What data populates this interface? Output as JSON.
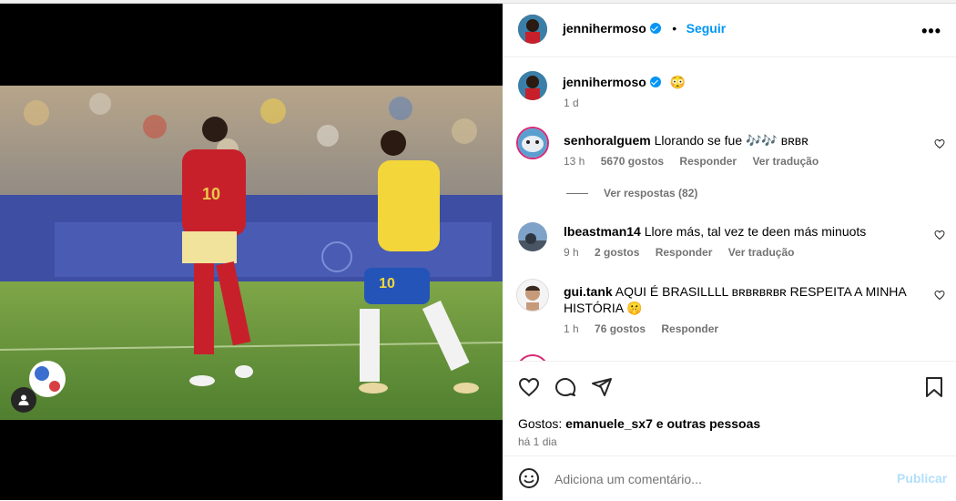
{
  "post_author": {
    "username": "jennihermoso",
    "follow_label": "Seguir",
    "more_icon": "more-icon"
  },
  "caption": {
    "username": "jennihermoso",
    "emoji": "😳",
    "time": "1 d"
  },
  "photo": {
    "player_left_number": "10",
    "player_right_number": "10"
  },
  "comments": [
    {
      "username": "senhoralguem",
      "text": "Llorando se fue 🎶🎶 ʙʀʙʀ",
      "time": "13 h",
      "likes": "5670 gostos",
      "reply": "Responder",
      "translate": "Ver tradução",
      "view_replies": "Ver respostas (82)"
    },
    {
      "username": "lbeastman14",
      "text": "Llore más, tal vez te deen más minuots",
      "time": "9 h",
      "likes": "2 gostos",
      "reply": "Responder",
      "translate": "Ver tradução"
    },
    {
      "username": "gui.tank",
      "text": "AQUI É BRASILLLL ʙʀʙʀʙʀʙʀ RESPEITA A MINHA HISTÓRIA 🤫",
      "time": "1 h",
      "likes": "76 gostos",
      "reply": "Responder"
    }
  ],
  "likes_line": {
    "prefix": "Gostos: ",
    "user": "emanuele_sx7",
    "rest": " e outras pessoas"
  },
  "post_time": "há 1 dia",
  "add_comment": {
    "placeholder": "Adiciona um comentário...",
    "publish": "Publicar"
  },
  "colors": {
    "accent": "#0095f6",
    "publish_disabled": "#b2dffc"
  }
}
